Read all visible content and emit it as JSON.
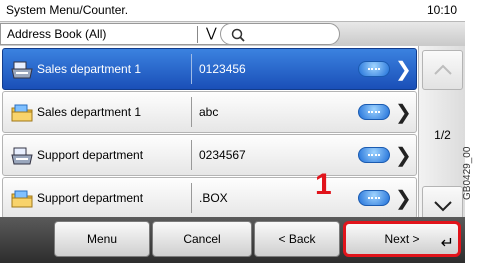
{
  "topbar": {
    "title": "System Menu/Counter.",
    "time": "10:10"
  },
  "filter": {
    "value": "Address Book (All)"
  },
  "rows": [
    {
      "name": "Sales department 1",
      "number": "0123456",
      "type": "machine",
      "selected": true
    },
    {
      "name": "Sales department 1",
      "number": "abc",
      "type": "folder",
      "selected": false
    },
    {
      "name": "Support department",
      "number": "0234567",
      "type": "machine",
      "selected": false
    },
    {
      "name": "Support department",
      "number": ".BOX",
      "type": "folder",
      "selected": false
    }
  ],
  "pager": {
    "label": "1/2"
  },
  "buttons": {
    "menu": "Menu",
    "cancel": "Cancel",
    "back": "< Back",
    "next": "Next >"
  },
  "annotation": {
    "callout": "1",
    "code": "GB0429_00"
  },
  "icons": {
    "select": "chevron-down-icon",
    "search": "search-icon",
    "machine": "fax-machine-icon",
    "folder": "folder-icon",
    "detail": "detail-icon",
    "row_arrow": "chevron-right-icon",
    "up": "scroll-up-icon",
    "down": "scroll-down-icon",
    "enter": "enter-icon"
  },
  "colors": {
    "selected_row": "#1a4fb8",
    "highlight": "#e1141b"
  }
}
